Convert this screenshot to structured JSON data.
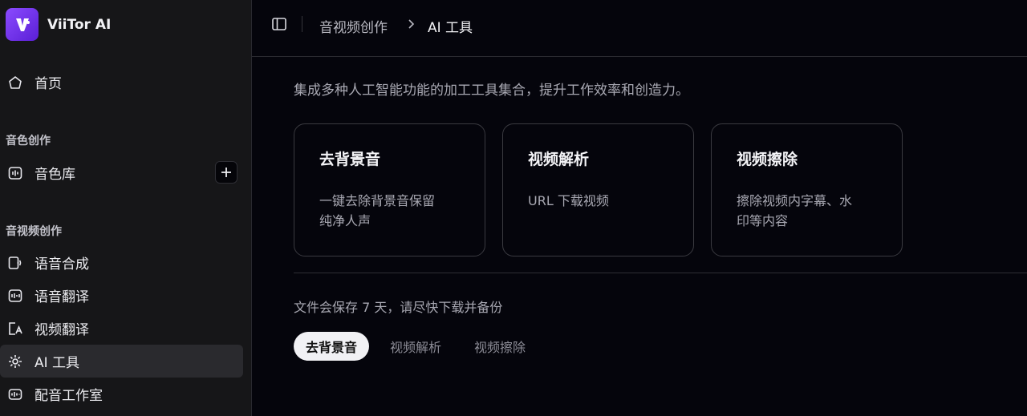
{
  "brand": {
    "name": "ViiTor AI",
    "logo_letter": "V"
  },
  "sidebar": {
    "home": {
      "label": "首页",
      "icon": "home-icon"
    },
    "section_voice": "音色创作",
    "voice_library": {
      "label": "音色库",
      "icon": "voice-library-icon"
    },
    "section_av": "音视频创作",
    "items": [
      {
        "label": "语音合成",
        "icon": "speech-synthesis-icon"
      },
      {
        "label": "语音翻译",
        "icon": "speech-translation-icon"
      },
      {
        "label": "视频翻译",
        "icon": "video-translation-icon"
      },
      {
        "label": "AI 工具",
        "icon": "ai-tools-icon",
        "active": true
      },
      {
        "label": "配音工作室",
        "icon": "dubbing-studio-icon"
      }
    ]
  },
  "breadcrumb": {
    "parent": "音视频创作",
    "current": "AI 工具"
  },
  "main": {
    "description": "集成多种人工智能功能的加工工具集合，提升工作效率和创造力。",
    "cards": [
      {
        "title": "去背景音",
        "desc_line1": "一键去除背景音保留",
        "desc_line2": "纯净人声"
      },
      {
        "title": "视频解析",
        "desc_line1": "URL 下载视频",
        "desc_line2": ""
      },
      {
        "title": "视频擦除",
        "desc_line1": "擦除视频内字幕、水",
        "desc_line2": "印等内容"
      }
    ],
    "notice": "文件会保存 7 天，请尽快下载并备份",
    "tabs": [
      {
        "label": "去背景音",
        "active": true
      },
      {
        "label": "视频解析",
        "active": false
      },
      {
        "label": "视频擦除",
        "active": false
      }
    ]
  },
  "colors": {
    "accent": "#7b3ff2",
    "sidebar_bg": "#161618",
    "main_bg": "#05050c"
  }
}
